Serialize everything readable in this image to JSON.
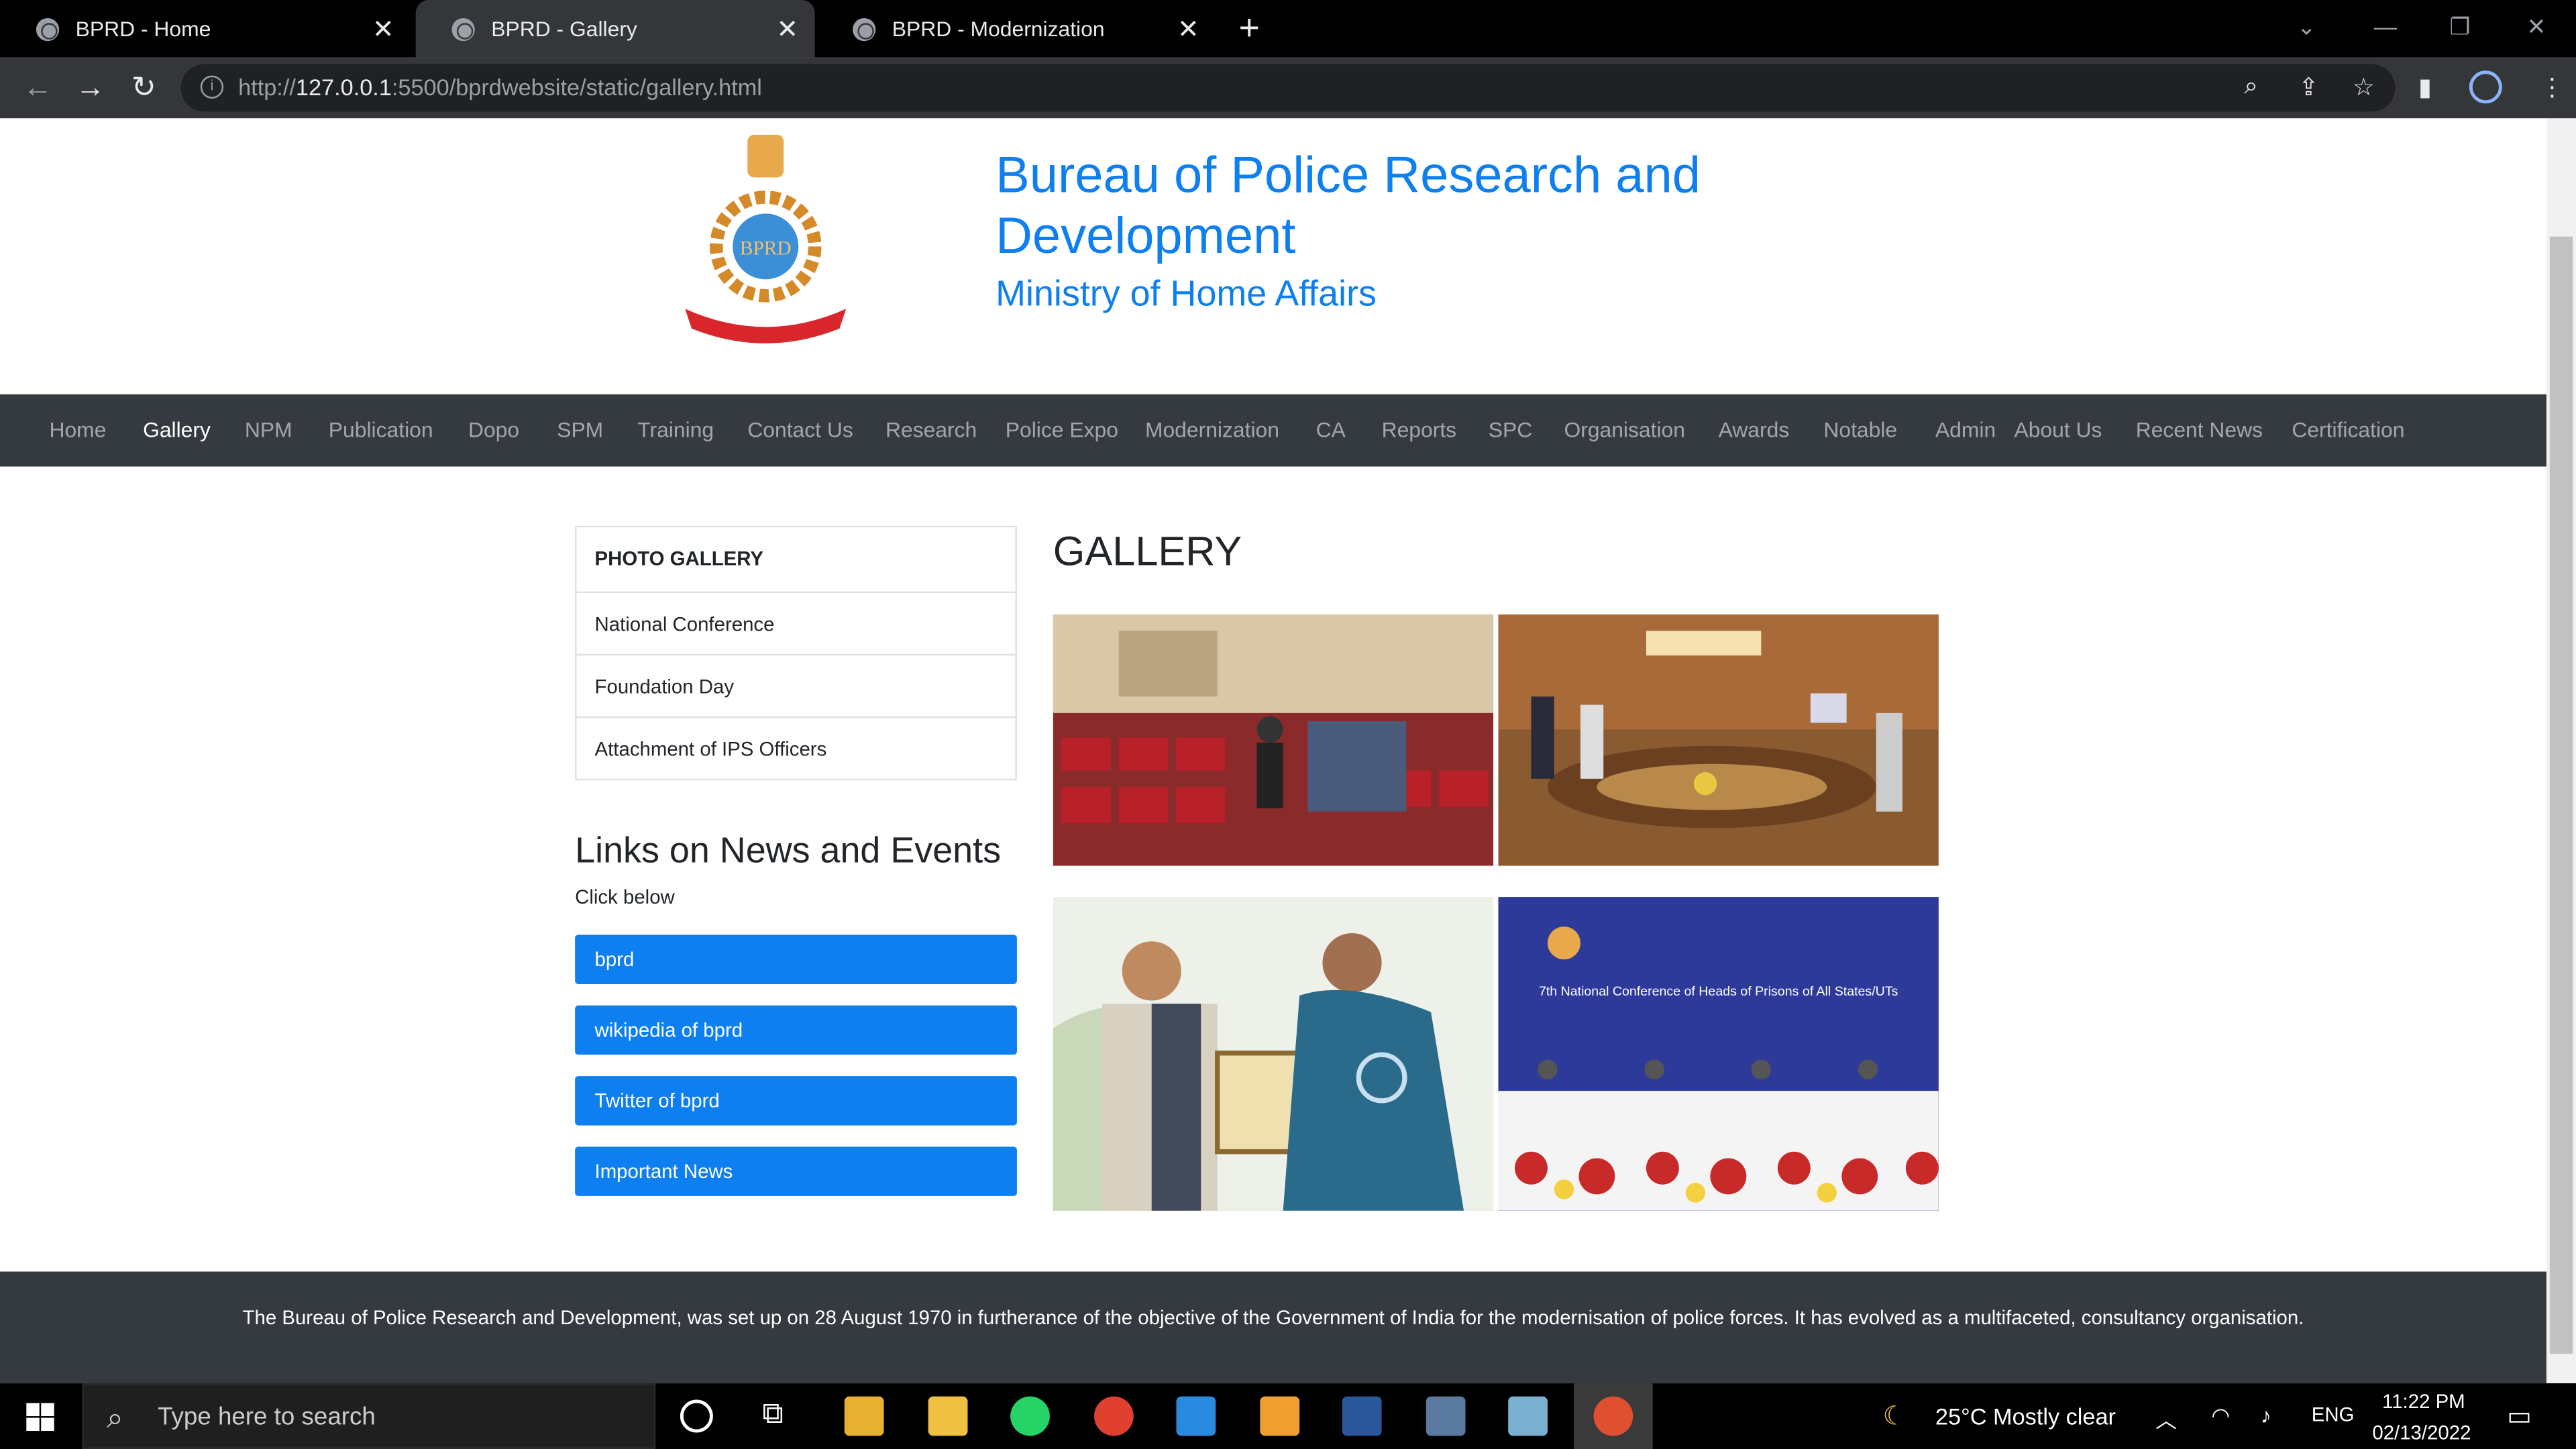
{
  "browser": {
    "tabs": [
      {
        "title": "BPRD - Home"
      },
      {
        "title": "BPRD - Gallery"
      },
      {
        "title": "BPRD - Modernization"
      }
    ],
    "url_host": "127.0.0.1",
    "url_rest": ":5500/bprdwebsite/static/gallery.html",
    "url_prefix": "http://"
  },
  "header": {
    "title": "Bureau of Police Research and Development",
    "subtitle": "Ministry of Home Affairs",
    "emblem_text": "BPRD"
  },
  "nav": {
    "items": [
      "Home",
      "Gallery",
      "NPM",
      "Publication",
      "Dopo",
      "SPM",
      "Training",
      "Contact Us",
      "Research",
      "Police Expo",
      "Modernization",
      "CA",
      "Reports",
      "SPC",
      "Organisation",
      "Awards",
      "Notable",
      "Admin",
      "About Us",
      "Recent News",
      "Certification"
    ],
    "active": "Gallery"
  },
  "sidebar": {
    "heading": "PHOTO GALLERY",
    "items": [
      "National Conference",
      "Foundation Day",
      "Attachment of IPS Officers"
    ],
    "news_heading": "Links on News and Events",
    "news_sub": "Click below",
    "buttons": [
      "bprd",
      "wikipedia of bprd",
      "Twitter of bprd",
      "Important News"
    ]
  },
  "gallery": {
    "heading": "GALLERY",
    "photos": [
      {
        "alt": "auditorium-conference-photo"
      },
      {
        "alt": "meeting-room-photo"
      },
      {
        "alt": "award-ceremony-photo"
      },
      {
        "alt": "national-conference-stage-photo",
        "banner": "7th National Conference of Heads of Prisons of All States/UTs"
      }
    ]
  },
  "footer": {
    "text": "The Bureau of Police Research and Development, was set up on 28 August 1970 in furtherance of the objective of the Government of India for the modernisation of police forces. It has evolved as a multifaceted, consultancy organisation."
  },
  "taskbar": {
    "search_placeholder": "Type here to search",
    "weather": "25°C  Mostly clear",
    "lang": "ENG",
    "time": "11:22 PM",
    "date": "02/13/2022"
  },
  "colors": {
    "accent": "#0d7ff0",
    "navbar": "#343a40"
  }
}
